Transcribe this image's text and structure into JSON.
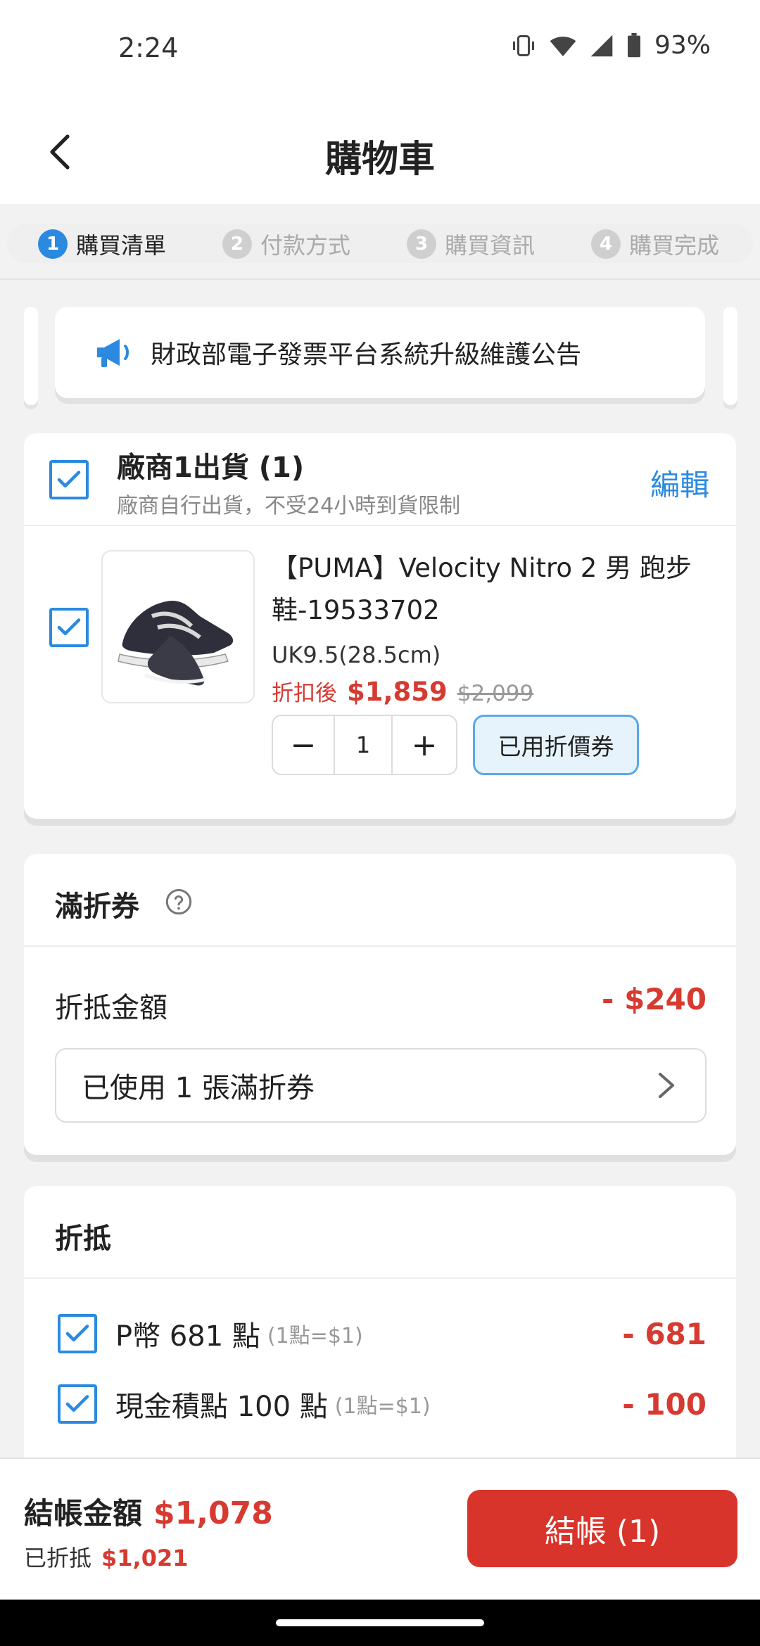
{
  "status": {
    "time": "2:24",
    "battery": "93%"
  },
  "header": {
    "title": "購物車"
  },
  "steps": [
    {
      "num": "1",
      "label": "購買清單",
      "active": true
    },
    {
      "num": "2",
      "label": "付款方式",
      "active": false
    },
    {
      "num": "3",
      "label": "購買資訊",
      "active": false
    },
    {
      "num": "4",
      "label": "購買完成",
      "active": false
    }
  ],
  "announcement": {
    "text": "財政部電子發票平台系統升級維護公告"
  },
  "vendor": {
    "title": "廠商1出貨 (1)",
    "subtitle": "廠商自行出貨，不受24小時到貨限制",
    "edit_label": "編輯"
  },
  "product": {
    "name": "【PUMA】Velocity Nitro 2 男 跑步鞋-19533702",
    "size": "UK9.5(28.5cm)",
    "price_label": "折扣後",
    "price_now": "$1,859",
    "price_old": "$2,099",
    "quantity": "1",
    "minus": "−",
    "plus": "+",
    "coupon_used_label": "已用折價券"
  },
  "coupon_section": {
    "title": "滿折券",
    "deduct_label": "折抵金額",
    "deduct_amount": "- $240",
    "select_text": "已使用 1 張滿折券"
  },
  "deduct_section": {
    "title": "折抵",
    "items": [
      {
        "label": "P幣 681 點",
        "note": "(1點=$1)",
        "amount": "- 681"
      },
      {
        "label": "現金積點 100 點",
        "note": "(1點=$1)",
        "amount": "- 100"
      }
    ]
  },
  "footer": {
    "total_label": "結帳金額",
    "total_value": "$1,078",
    "saved_label": "已折抵",
    "saved_value": "$1,021",
    "checkout_label": "結帳 (1)"
  },
  "colors": {
    "accent": "#2b8ae0",
    "price": "#d63a30",
    "checkout": "#d8342b"
  }
}
